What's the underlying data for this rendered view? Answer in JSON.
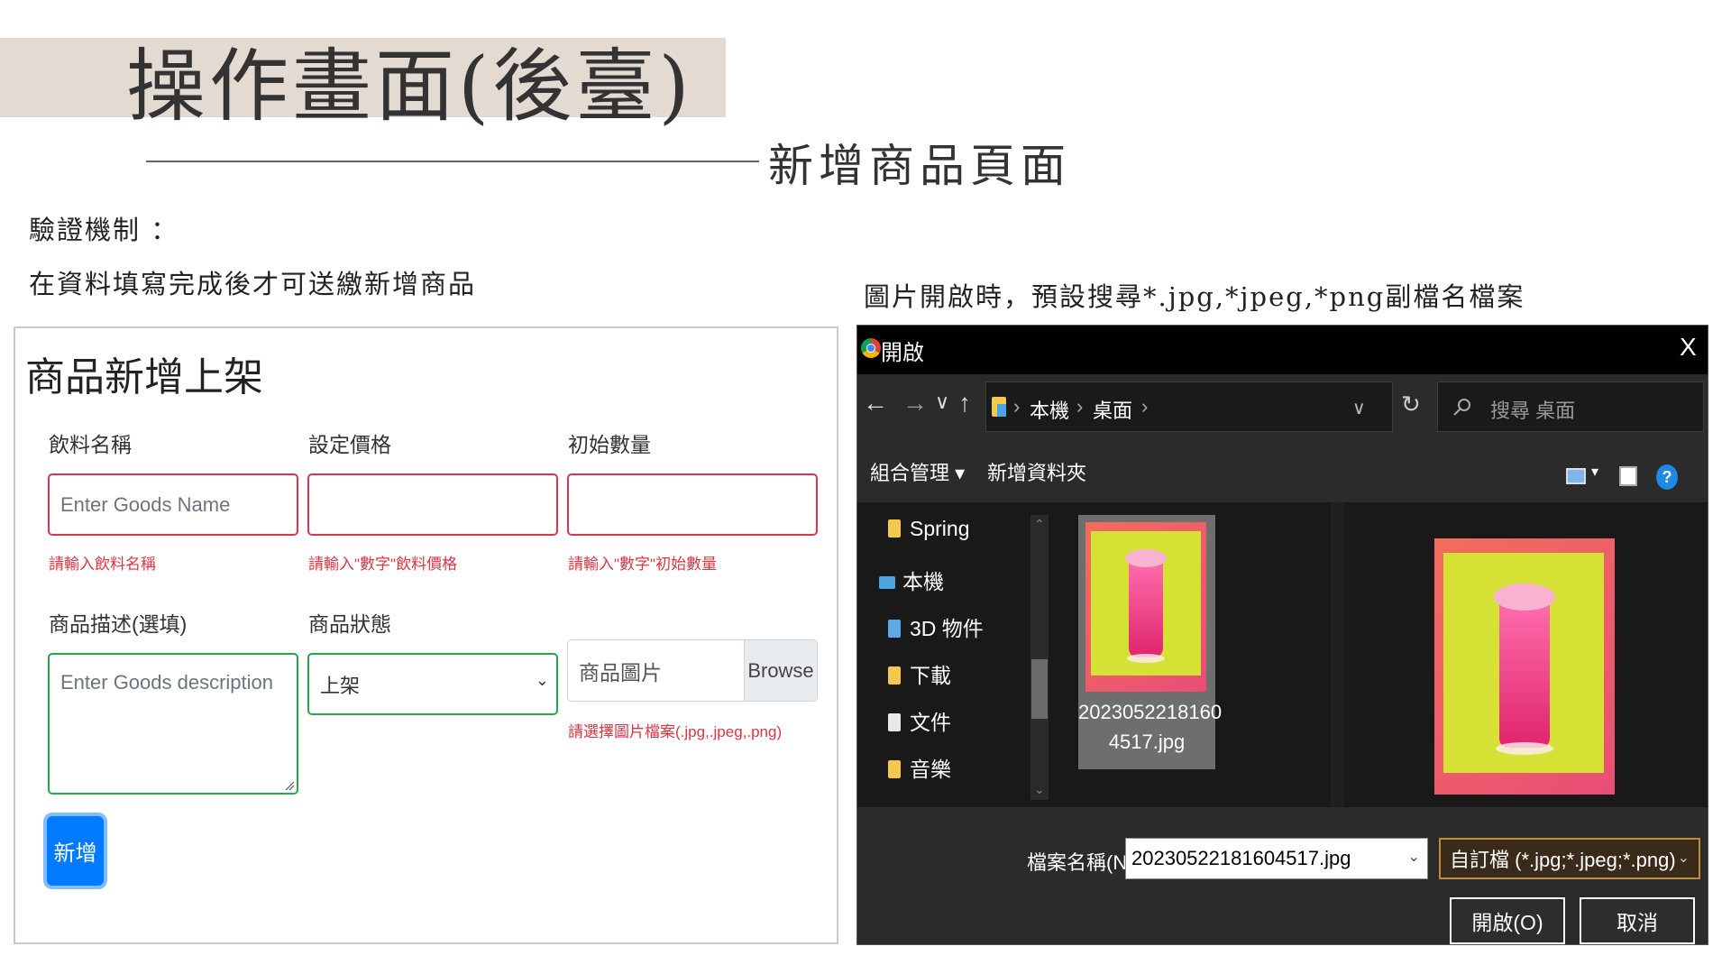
{
  "slide": {
    "title": "操作畫面(後臺)",
    "subtitle": "新增商品頁面",
    "validation_heading": "驗證機制  ：",
    "validation_text": "在資料填寫完成後才可送繳新增商品",
    "dialog_note": "圖片開啟時，預設搜尋*.jpg,*jpeg,*png副檔名檔案"
  },
  "form": {
    "title": "商品新增上架",
    "fields": {
      "name": {
        "label": "飲料名稱",
        "placeholder": "Enter Goods Name",
        "error": "請輸入飲料名稱"
      },
      "price": {
        "label": "設定價格",
        "value": "",
        "error": "請輸入\"數字\"飲料價格"
      },
      "quantity": {
        "label": "初始數量",
        "value": "",
        "error": "請輸入\"數字\"初始數量"
      },
      "description": {
        "label": "商品描述(選填)",
        "placeholder": "Enter Goods description"
      },
      "status": {
        "label": "商品狀態",
        "selected": "上架"
      },
      "image": {
        "label": "商品圖片",
        "browse": "Browse",
        "error": "請選擇圖片檔案(.jpg,.jpeg,.png)"
      }
    },
    "submit_label": "新增",
    "colors": {
      "error": "#dc3545",
      "valid": "#28a745",
      "primary": "#007bff"
    }
  },
  "dialog": {
    "title": "開啟",
    "close": "X",
    "nav": {
      "back": "←",
      "forward": "→",
      "recent": "∨",
      "up": "↑",
      "refresh": "↻",
      "dropdown": "∨"
    },
    "breadcrumb": [
      "本機",
      "桌面"
    ],
    "search_placeholder": "搜尋 桌面",
    "toolbar": {
      "organize": "組合管理 ▾",
      "new_folder": "新增資料夾",
      "view_menu": "▾",
      "help": "?"
    },
    "nav_items": [
      {
        "label": "Spring",
        "icon": "folder-icon"
      },
      {
        "label": "本機",
        "icon": "computer-icon"
      },
      {
        "label": "3D 物件",
        "icon": "folder-icon"
      },
      {
        "label": "下載",
        "icon": "folder-icon"
      },
      {
        "label": "文件",
        "icon": "document-icon"
      },
      {
        "label": "音樂",
        "icon": "folder-icon"
      }
    ],
    "file": {
      "name_line1": "2023052218160",
      "name_line2": "4517.jpg"
    },
    "filename_label": "檔案名稱(N):",
    "filename_value": "20230522181604517.jpg",
    "filetype": "自訂檔 (*.jpg;*.jpeg;*.png)",
    "open_button": "開啟(O)",
    "cancel_button": "取消",
    "colors": {
      "titlebar": "#000000",
      "panel": "#2b2b2b",
      "accent": "#c08a3e"
    }
  }
}
